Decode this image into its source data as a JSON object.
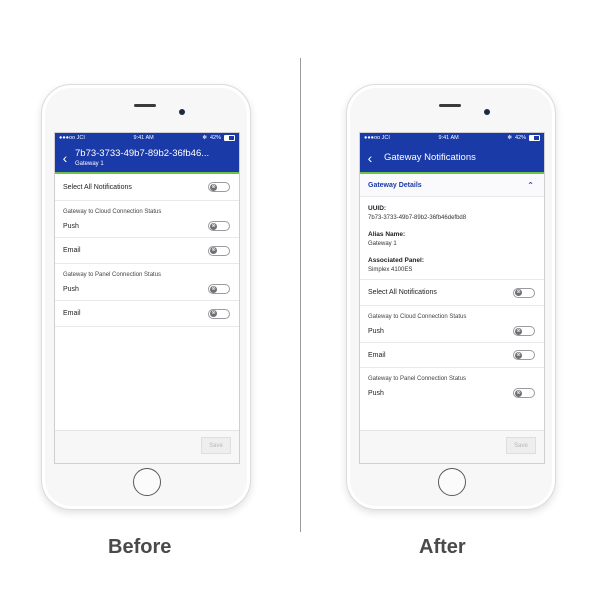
{
  "before": {
    "status": {
      "carrier": "●●●oo JCI",
      "time": "9:41 AM",
      "bluetooth": "✻",
      "battery": "42%"
    },
    "nav": {
      "title": "7b73-3733-49b7-89b2-36fb46...",
      "subtitle": "Gateway 1"
    },
    "select_all": "Select All Notifications",
    "sections": [
      {
        "label": "Gateway to Cloud Connection Status",
        "items": [
          "Push",
          "Email"
        ]
      },
      {
        "label": "Gateway to Panel Connection Status",
        "items": [
          "Push",
          "Email"
        ]
      }
    ],
    "save": "Save"
  },
  "after": {
    "status": {
      "carrier": "●●●oo JCI",
      "time": "9:41 AM",
      "bluetooth": "✻",
      "battery": "42%"
    },
    "nav": {
      "title": "Gateway Notifications"
    },
    "details": {
      "header": "Gateway Details",
      "uuid_label": "UUID:",
      "uuid_value": "7b73-3733-49b7-89b2-36fb46defbd8",
      "alias_label": "Alias Name:",
      "alias_value": "Gateway 1",
      "panel_label": "Associated Panel:",
      "panel_value": "Simplex 4100ES"
    },
    "select_all": "Select All Notifications",
    "sections": [
      {
        "label": "Gateway to Cloud Connection Status",
        "items": [
          "Push",
          "Email"
        ]
      },
      {
        "label": "Gateway to Panel Connection Status",
        "items": [
          "Push"
        ]
      }
    ],
    "save": "Save"
  },
  "captions": {
    "before": "Before",
    "after": "After"
  },
  "colors": {
    "brand_blue": "#1a3aa8",
    "accent_green": "#6cc24a"
  },
  "icons": {
    "back": "‹",
    "chevron_up": "⌃",
    "toggle_off": "⊗"
  }
}
